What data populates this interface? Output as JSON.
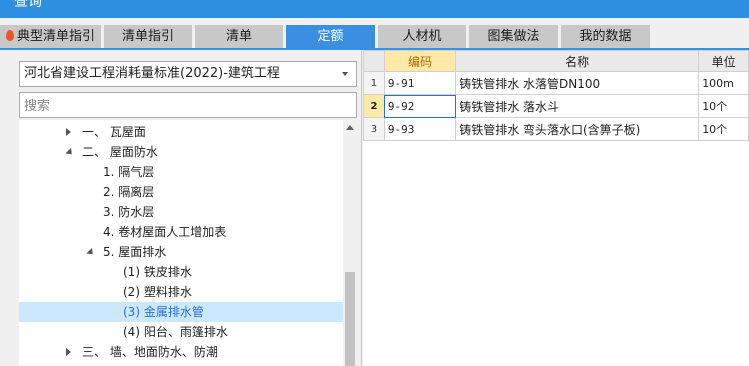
{
  "window": {
    "title": "查询"
  },
  "tabs": [
    {
      "label": "典型清单指引",
      "icon": "flame-icon",
      "active": false
    },
    {
      "label": "清单指引",
      "active": false
    },
    {
      "label": "清单",
      "active": false
    },
    {
      "label": "定额",
      "active": true
    },
    {
      "label": "人材机",
      "active": false
    },
    {
      "label": "图集做法",
      "active": false
    },
    {
      "label": "我的数据",
      "active": false
    }
  ],
  "library": {
    "selected": "河北省建设工程消耗量标准(2022)-建筑工程"
  },
  "search": {
    "placeholder": "搜索"
  },
  "tree": [
    {
      "label": "一、 瓦屋面",
      "expanded": false,
      "level": 0
    },
    {
      "label": "二、 屋面防水",
      "expanded": true,
      "level": 0
    },
    {
      "label": "1. 隔气层",
      "level": 1
    },
    {
      "label": "2. 隔离层",
      "level": 1
    },
    {
      "label": "3. 防水层",
      "level": 1
    },
    {
      "label": "4. 卷材屋面人工增加表",
      "level": 1
    },
    {
      "label": "5. 屋面排水",
      "expanded": true,
      "level": 1
    },
    {
      "label": "(1) 铁皮排水",
      "level": 2
    },
    {
      "label": "(2) 塑料排水",
      "level": 2
    },
    {
      "label": "(3) 金属排水管",
      "level": 2,
      "selected": true
    },
    {
      "label": "(4) 阳台、雨篷排水",
      "level": 2
    },
    {
      "label": "三、 墙、地面防水、防潮",
      "expanded": false,
      "level": 0
    }
  ],
  "table": {
    "columns": {
      "code": "编码",
      "name": "名称",
      "unit": "单位"
    },
    "rows": [
      {
        "idx": "1",
        "code": "9-91",
        "name": "铸铁管排水 水落管DN100",
        "unit": "100m"
      },
      {
        "idx": "2",
        "code": "9-92",
        "name": "铸铁管排水 落水斗",
        "unit": "10个"
      },
      {
        "idx": "3",
        "code": "9-93",
        "name": "铸铁管排水 弯头落水口(含箅子板)",
        "unit": "10个"
      }
    ],
    "current_row": "2"
  },
  "colors": {
    "accent": "#3c8fe0",
    "selected_row": "#cce8ff",
    "header_highlight": "#ffe8a8"
  }
}
